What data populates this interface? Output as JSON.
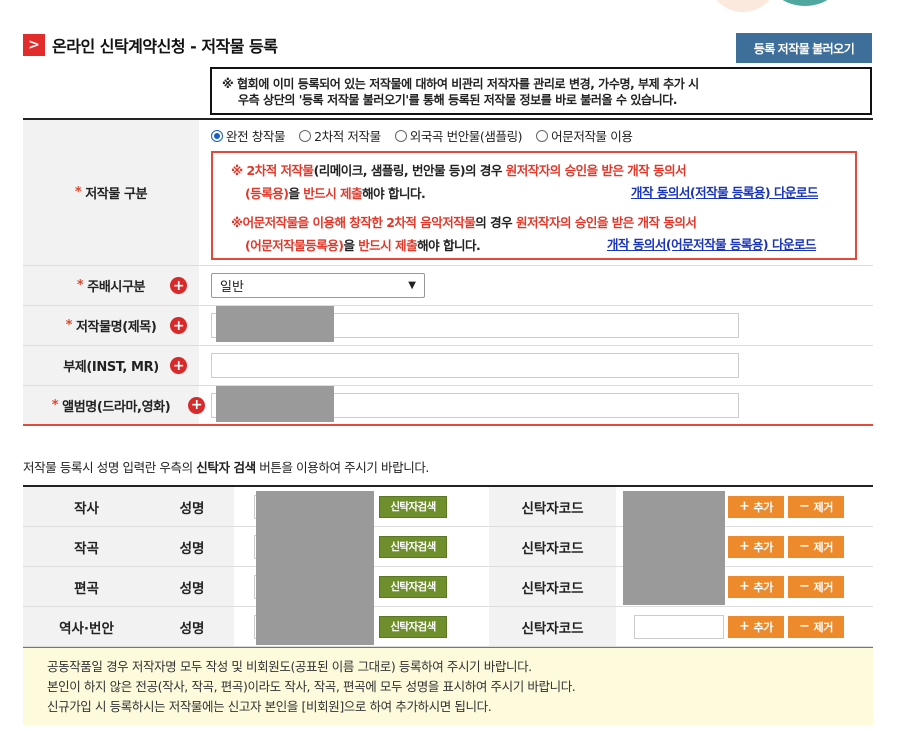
{
  "header": {
    "title_icon": ">",
    "title": "온라인 신탁계약신청 - 저작물 등록",
    "load_button": "등록 저작물 불러오기"
  },
  "notice": {
    "line1": "※ 협회에 이미 등록되어 있는 저작물에 대하여 비관리 저작자를 관리로 변경, 가수명, 부제 추가 시",
    "line2": "우측 상단의 '등록 저작물 불러오기'를 통해 등록된 저작물 정보를 바로 불러올 수 있습니다."
  },
  "form": {
    "required_mark": "*",
    "type": {
      "label": "저작물 구분",
      "options": [
        "완전 창작물",
        "2차적 저작물",
        "외국곡 번안물(샘플링)",
        "어문저작물 이용"
      ],
      "selected": "완전 창작물",
      "warning": {
        "w1_a": "※ 2차적 저작물",
        "w1_b": "(리메이크, 샘플링, 번안물 등)의 경우 ",
        "w1_c": "원저작자의 승인을 받은 개작 동의서",
        "w2_a": "(등록용)",
        "w2_b": "을 ",
        "w2_c": "반드시 제출",
        "w2_d": "해야 합니다.",
        "link1": "개작 동의서(저작물 등록용) 다운로드",
        "w3_a": "※어문저작물을 이용해 창작한 2차적 음악저작물",
        "w3_b": "의 경우 ",
        "w3_c": "원저작자의 승인을 받은 개작 동의서",
        "w4_a": "(어문저작물등록용)",
        "w4_b": "을 ",
        "w4_c": "반드시 제출",
        "w4_d": "해야 합니다.",
        "link2": "개작 동의서(어문저작물 등록용) 다운로드"
      }
    },
    "distribution": {
      "label": "주배시구분",
      "value": "일반"
    },
    "title_field": {
      "label": "저작물명(제목)",
      "value": ""
    },
    "subtitle_field": {
      "label": "부제(INST, MR)",
      "value": ""
    },
    "album_field": {
      "label": "앨범명(드라마,영화)",
      "value": ""
    }
  },
  "trust_info": "저작물 등록시 성명 입력란 우측의 ",
  "trust_info_bold": "신탁자 검색",
  "trust_info_tail": " 버튼을 이용하여 주시기 바랍니다.",
  "trust_table": {
    "name_label": "성명",
    "search_label": "신탁자검색",
    "code_label": "신탁자코드",
    "add_label": "추가",
    "del_label": "제거",
    "rows": [
      {
        "role": "작사"
      },
      {
        "role": "작곡"
      },
      {
        "role": "편곡"
      },
      {
        "role": "역사·번안"
      }
    ]
  },
  "bottom_notes": [
    "공동작품일 경우 저작자명 모두 작성 및 비회원도(공표된 이름 그대로) 등록하여 주시기 바랍니다.",
    "본인이 하지 않은 전공(작사, 작곡, 편곡)이라도 작사, 작곡, 편곡에 모두 성명을 표시하여 주시기 바랍니다.",
    "신규가입 시 등록하시는 저작물에는 신고자 본인을 [비회원]으로 하여 추가하시면 됩니다."
  ]
}
